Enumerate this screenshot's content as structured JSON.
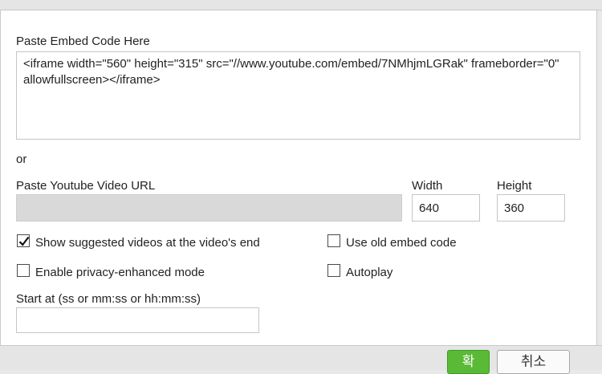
{
  "embed": {
    "label": "Paste Embed Code Here",
    "code": "<iframe width=\"560\" height=\"315\" src=\"//www.youtube.com/embed/7NMhjmLGRak\" frameborder=\"0\" allowfullscreen></iframe>"
  },
  "or_text": "or",
  "url": {
    "label": "Paste Youtube Video URL",
    "value": ""
  },
  "width": {
    "label": "Width",
    "value": "640"
  },
  "height": {
    "label": "Height",
    "value": "360"
  },
  "options": {
    "show_suggested": {
      "label": "Show suggested videos at the video's end",
      "checked": true
    },
    "old_embed": {
      "label": "Use old embed code",
      "checked": false
    },
    "privacy": {
      "label": "Enable privacy-enhanced mode",
      "checked": false
    },
    "autoplay": {
      "label": "Autoplay",
      "checked": false
    }
  },
  "start": {
    "label": "Start at (ss or mm:ss or hh:mm:ss)",
    "value": ""
  },
  "buttons": {
    "ok_label": "확",
    "cancel_label": "취소"
  },
  "colors": {
    "ok_bg": "#5ab936",
    "url_field_bg": "#d9d9d9"
  },
  "icons": {
    "checkmark": "check-icon"
  }
}
